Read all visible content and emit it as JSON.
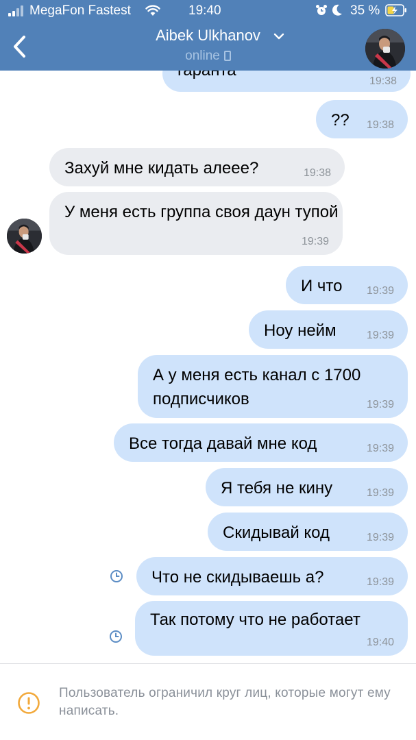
{
  "status_bar": {
    "carrier": "MegaFon Fastest",
    "time": "19:40",
    "battery": "35 %"
  },
  "header": {
    "name": "Aibek Ulkhanov",
    "status": "online"
  },
  "messages": [
    {
      "dir": "out",
      "text": "гаранта",
      "time": "19:38"
    },
    {
      "dir": "out",
      "text": "??",
      "time": "19:38"
    },
    {
      "dir": "in",
      "text": "Захуй мне кидать алеее?",
      "time": "19:38"
    },
    {
      "dir": "in",
      "text": "У меня есть группа своя даун тупой",
      "time": "19:39"
    },
    {
      "dir": "out",
      "text": "И что",
      "time": "19:39"
    },
    {
      "dir": "out",
      "text": "Ноу нейм",
      "time": "19:39"
    },
    {
      "dir": "out",
      "text": "А у меня есть канал с 1700 подписчиков",
      "time": "19:39"
    },
    {
      "dir": "out",
      "text": "Все тогда давай мне код",
      "time": "19:39"
    },
    {
      "dir": "out",
      "text": "Я тебя не кину",
      "time": "19:39"
    },
    {
      "dir": "out",
      "text": "Скидывай код",
      "time": "19:39"
    },
    {
      "dir": "out",
      "text": "Что не скидываешь а?",
      "time": "19:39",
      "pending": true
    },
    {
      "dir": "out",
      "text": "Так потому что не работает",
      "time": "19:40",
      "pending": true
    }
  ],
  "footer": {
    "notice": "Пользователь ограничил круг лиц, которые могут ему написать."
  },
  "colors": {
    "header_bg": "#5181b8",
    "outgoing_bubble": "#cfe3fb",
    "incoming_bubble": "#eaecf0",
    "warning": "#f2a93b",
    "pending_clock": "#5b8cc4"
  },
  "icons": [
    "signal-icon",
    "wifi-icon",
    "alarm-icon",
    "moon-icon",
    "battery-icon",
    "back-icon",
    "chevron-down-icon",
    "phone-icon",
    "clock-icon",
    "warning-icon"
  ]
}
